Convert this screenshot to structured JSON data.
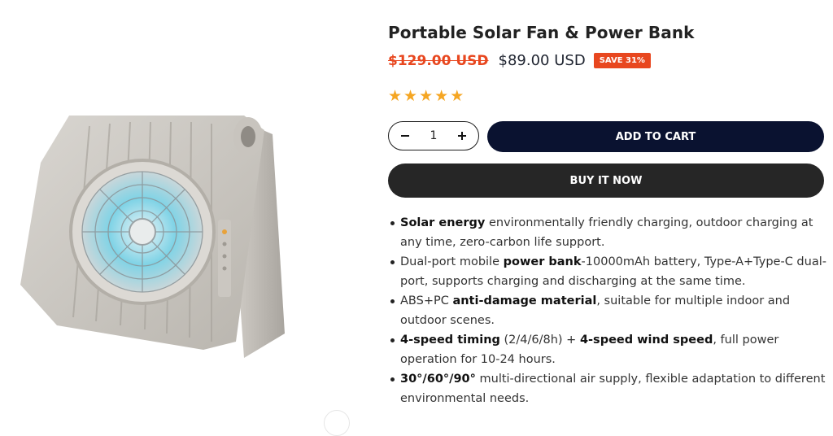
{
  "product": {
    "title": "Portable Solar Fan & Power Bank",
    "old_price": "$129.00 USD",
    "new_price": "$89.00 USD",
    "save_badge": "SAVE 31%",
    "rating": 5,
    "rating_max": 5,
    "image_icon": "solar-fan-product-image"
  },
  "purchase": {
    "quantity": "1",
    "minus_icon": "minus-icon",
    "plus_icon": "plus-icon",
    "add_to_cart": "ADD TO CART",
    "buy_now": "BUY IT NOW"
  },
  "features": [
    {
      "parts": [
        {
          "t": "Solar energy",
          "b": true
        },
        {
          "t": " environmentally friendly charging, outdoor charging at any time, zero-carbon life support.",
          "b": false
        }
      ]
    },
    {
      "parts": [
        {
          "t": "Dual-port mobile ",
          "b": false
        },
        {
          "t": "power bank",
          "b": true
        },
        {
          "t": "-10000mAh battery, Type-A+Type-C dual-port, supports charging and discharging at the same time.",
          "b": false
        }
      ]
    },
    {
      "parts": [
        {
          "t": "ABS+PC ",
          "b": false
        },
        {
          "t": "anti-damage material",
          "b": true
        },
        {
          "t": ", suitable for multiple indoor and outdoor scenes.",
          "b": false
        }
      ]
    },
    {
      "parts": [
        {
          "t": "4-speed timing",
          "b": true
        },
        {
          "t": " (2/4/6/8h) + ",
          "b": false
        },
        {
          "t": "4-speed wind speed",
          "b": true
        },
        {
          "t": ", full power operation for 10-24 hours.",
          "b": false
        }
      ]
    },
    {
      "parts": [
        {
          "t": "30°/60°/90°",
          "b": true
        },
        {
          "t": " multi-directional air supply, flexible adaptation to different environmental needs.",
          "b": false
        }
      ]
    }
  ],
  "colors": {
    "accent": "#e8471f",
    "cart_button": "#0a1230",
    "buy_button": "#262626",
    "star": "#f5a623"
  }
}
